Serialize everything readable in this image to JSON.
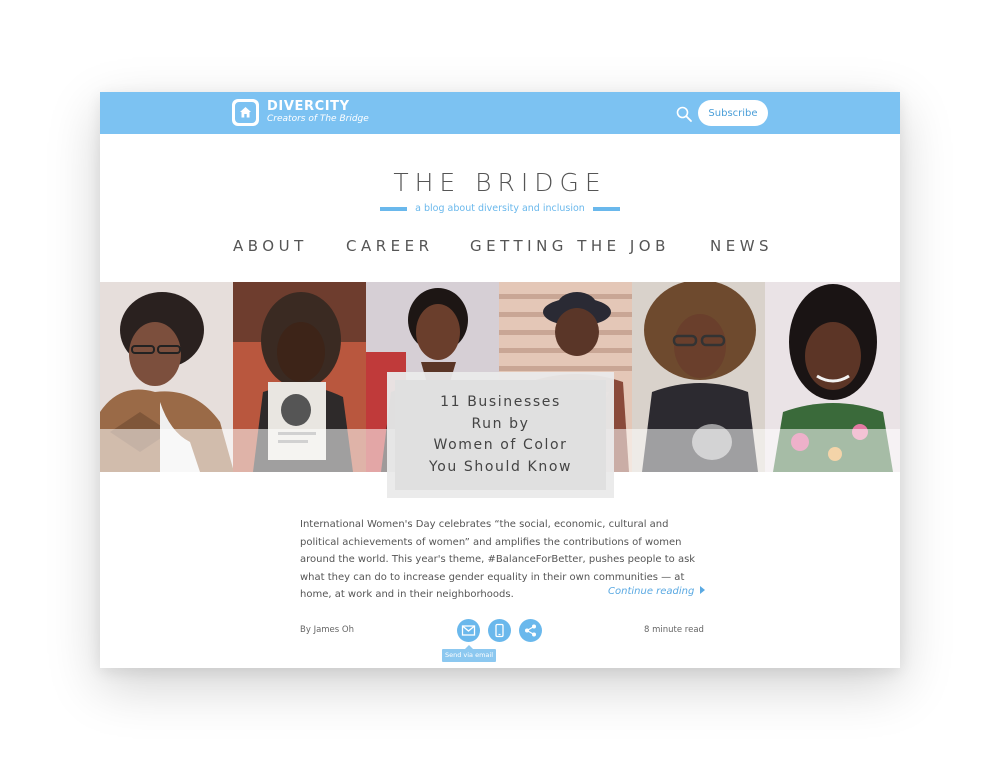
{
  "header": {
    "brand_name": "DIVERCITY",
    "brand_tagline": "Creators of The Bridge",
    "subscribe_label": "Subscribe",
    "accent_color": "#7cc2f2"
  },
  "masthead": {
    "title": "THE BRIDGE",
    "tagline": "a blog about diversity and inclusion"
  },
  "nav": {
    "items": [
      {
        "label": "ABOUT"
      },
      {
        "label": "CAREER"
      },
      {
        "label": "GETTING THE JOB"
      },
      {
        "label": "NEWS"
      }
    ]
  },
  "hero": {
    "headline_lines": [
      "11 Businesses",
      "Run by",
      "Women of Color",
      "You Should Know"
    ],
    "portraits": [
      "portrait-1",
      "portrait-2",
      "portrait-3",
      "portrait-4",
      "portrait-5",
      "portrait-6"
    ]
  },
  "article": {
    "excerpt_lines": [
      "International Women's Day celebrates “the social, economic, cultural and",
      "political achievements of women” and amplifies the contributions of women",
      "around the world. This year's theme, #BalanceForBetter, pushes people to ask",
      "what they can do to increase gender equality in their own communities — at",
      "home, at work and in their neighborhoods."
    ],
    "continue_label": "Continue reading",
    "byline": "By James Oh",
    "read_time": "8 minute read",
    "share_tooltip": "Send via email",
    "share_icons": [
      "email-icon",
      "mobile-icon",
      "share-icon"
    ]
  }
}
